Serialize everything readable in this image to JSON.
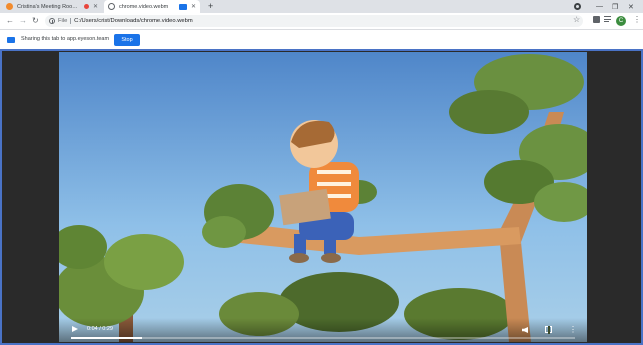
{
  "tabs": [
    {
      "title": "Cristina's Meeting Room | e",
      "favicon_color": "#f28b2d",
      "recording": true
    },
    {
      "title": "chrome.video.webm",
      "favicon_color": "#5f6368",
      "casting": true
    }
  ],
  "toolbar": {
    "url_scheme": "File",
    "url": "C:/Users/crist/Downloads/chrome.video.webm",
    "profile_initial": "C"
  },
  "sharing_bar": {
    "message": "Sharing this tab to app.eyeson.team",
    "stop_label": "Stop"
  },
  "video_player": {
    "current_time": "0:04",
    "duration": "0:29",
    "time_display": "0:04 / 0:29",
    "progress": 0.14
  },
  "icons": {
    "back": "back-arrow-icon",
    "forward": "forward-arrow-icon",
    "reload": "reload-icon",
    "info": "info-icon",
    "star": "bookmark-star-icon",
    "extensions": "puzzle-icon",
    "media": "media-control-icon",
    "menu": "kebab-menu-icon"
  },
  "colors": {
    "accent": "#1a73e8",
    "record": "#e8453c",
    "frame_border": "#4a73c6"
  }
}
